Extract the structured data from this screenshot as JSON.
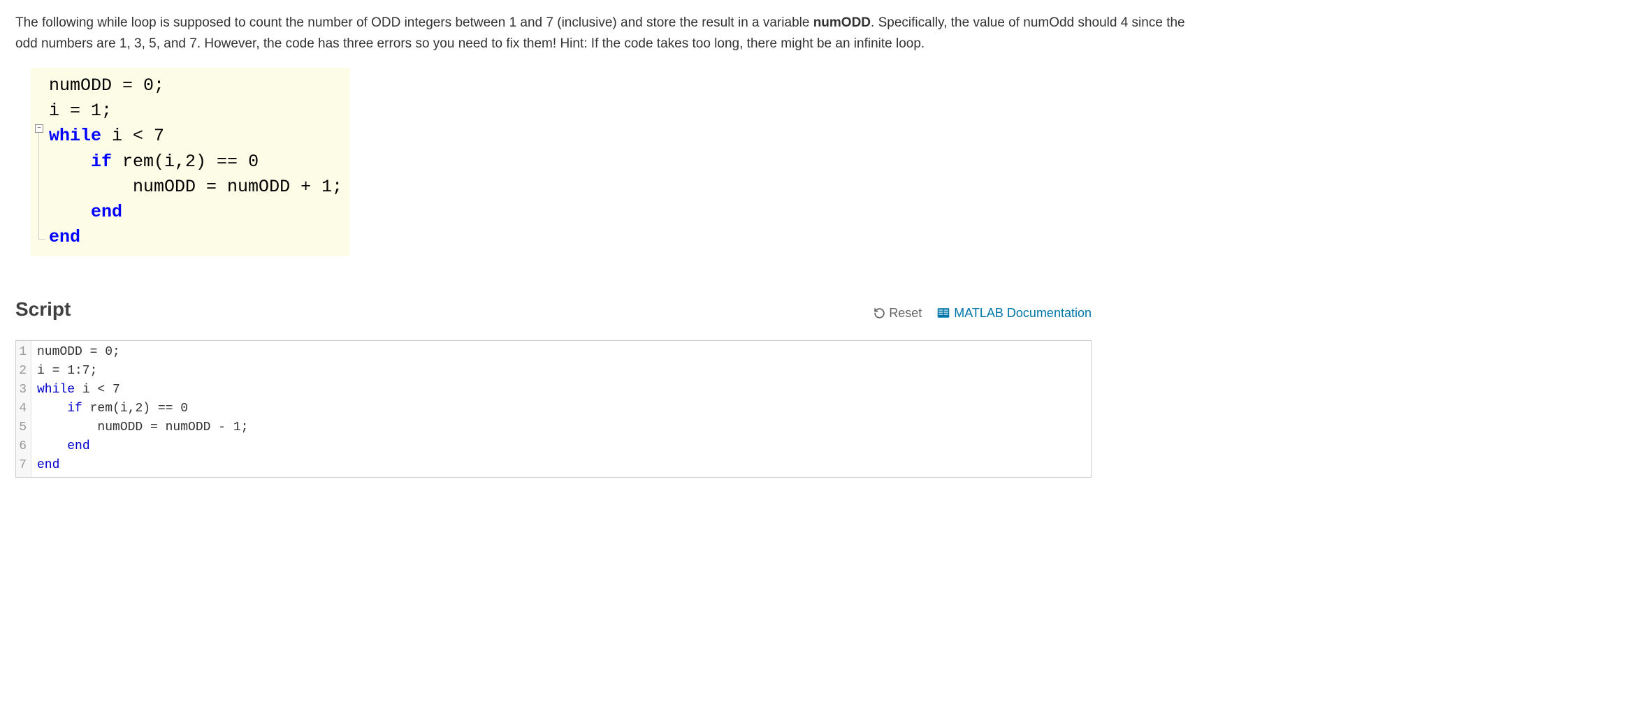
{
  "problem": {
    "text_part1": "The following while loop is supposed to count the number of ODD integers  between 1 and 7 (inclusive) and store the result in a variable ",
    "var_name": "numODD",
    "text_part2": ".   Specifically, the value of numOdd should 4 since the odd numbers are 1, 3, 5, and 7. However, the code has three errors so you need to fix them! Hint: If the code takes too long, there might be an infinite loop."
  },
  "reference_code": {
    "line1_a": "numODD = 0;",
    "line2_a": "i = 1;",
    "line3_kw": "while",
    "line3_rest": " i < 7",
    "line4_kw": "if",
    "line4_rest": " rem(i,2) == 0",
    "line5": "numODD = numODD + 1;",
    "line6_kw": "end",
    "line7_kw": "end"
  },
  "section": {
    "title": "Script",
    "reset_label": "Reset",
    "doc_label": "MATLAB Documentation"
  },
  "editor": {
    "gutter": "1\n2\n3\n4\n5\n6\n7",
    "lines": [
      {
        "plain": "numODD = 0;"
      },
      {
        "plain": "i = 1:7;"
      },
      {
        "kw": "while",
        "rest": " i < 7"
      },
      {
        "indent": "    ",
        "kw": "if",
        "rest": " rem(i,2) == 0"
      },
      {
        "plain": "        numODD = numODD - 1;"
      },
      {
        "indent": "    ",
        "kw": "end"
      },
      {
        "kw": "end"
      }
    ]
  }
}
